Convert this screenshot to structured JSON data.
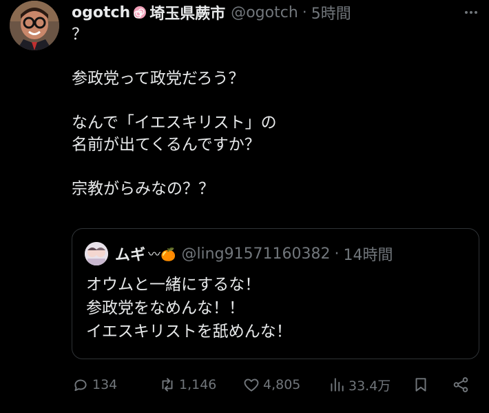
{
  "tweet": {
    "author_name": "ogotch",
    "author_location": "埼玉県蕨市",
    "author_handle": "@ogotch",
    "separator": "·",
    "time": "5時間",
    "lines": [
      "？",
      "",
      "参政党って政党だろう？",
      "",
      "なんで「イエスキリスト」の",
      "名前が出てくるんですか？",
      "",
      "宗教がらみなの？？"
    ]
  },
  "quote": {
    "author_name": "ムギ",
    "author_emoji": "〰🍊",
    "author_handle": "@ling91571160382",
    "separator": "·",
    "time": "14時間",
    "lines": [
      "オウムと一緒にするな！",
      "参政党をなめんな！！",
      "イエスキリストを舐めんな！"
    ]
  },
  "actions": {
    "replies": "134",
    "retweets": "1,146",
    "likes": "4,805",
    "views": "33.4万"
  },
  "colors": {
    "background": "#000000",
    "text": "#e7e9ea",
    "muted": "#71767b",
    "border": "#2f3336",
    "badge": "#f0a0b8"
  }
}
